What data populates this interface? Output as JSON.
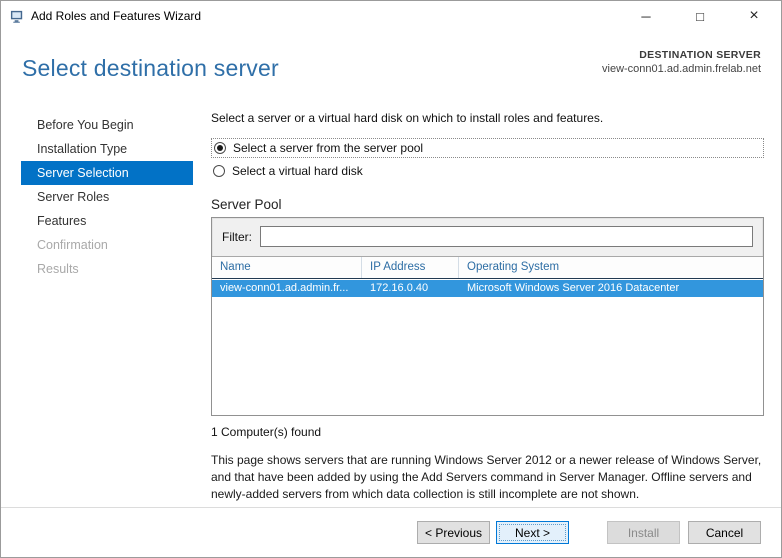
{
  "window": {
    "title": "Add Roles and Features Wizard",
    "icons": {
      "minimize": "─",
      "maximize": "□",
      "close": "×"
    }
  },
  "header": {
    "page_title": "Select destination server",
    "destination_label": "DESTINATION SERVER",
    "destination_value": "view-conn01.ad.admin.frelab.net"
  },
  "sidebar": {
    "items": [
      {
        "label": "Before You Begin",
        "state": "enabled"
      },
      {
        "label": "Installation Type",
        "state": "enabled"
      },
      {
        "label": "Server Selection",
        "state": "active"
      },
      {
        "label": "Server Roles",
        "state": "enabled"
      },
      {
        "label": "Features",
        "state": "enabled"
      },
      {
        "label": "Confirmation",
        "state": "disabled"
      },
      {
        "label": "Results",
        "state": "disabled"
      }
    ]
  },
  "main": {
    "intro": "Select a server or a virtual hard disk on which to install roles and features.",
    "radios": {
      "server_pool": "Select a server from the server pool",
      "vhd": "Select a virtual hard disk"
    },
    "server_pool": {
      "title": "Server Pool",
      "filter_label": "Filter:",
      "filter_value": "",
      "table": {
        "columns": [
          "Name",
          "IP Address",
          "Operating System"
        ],
        "rows": [
          {
            "cells": [
              "view-conn01.ad.admin.fr...",
              "172.16.0.40",
              "Microsoft Windows Server 2016 Datacenter"
            ],
            "selected": true
          }
        ]
      },
      "count_text": "1 Computer(s) found"
    },
    "description": "This page shows servers that are running Windows Server 2012 or a newer release of Windows Server, and that have been added by using the Add Servers command in Server Manager. Offline servers and newly-added servers from which data collection is still incomplete are not shown."
  },
  "footer": {
    "previous": "< Previous",
    "next": "Next >",
    "install": "Install",
    "cancel": "Cancel"
  },
  "colors": {
    "page_title_blue": "#2f6fa8",
    "sidebar_active_bg": "#0272c6",
    "selected_row_bg": "#3296dd",
    "column_header_blue": "#2d6da4",
    "next_button_border": "#0078d7",
    "next_button_bg": "#e3f0fb"
  }
}
